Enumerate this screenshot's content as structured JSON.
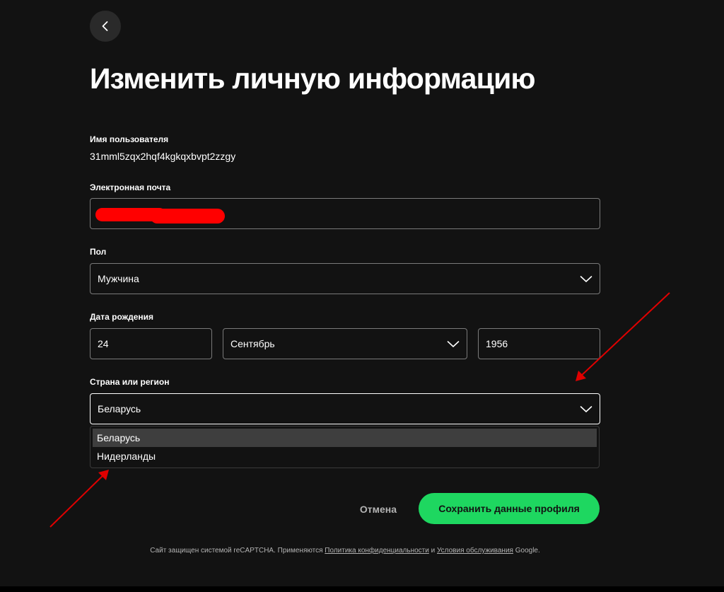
{
  "back_button": {
    "icon": "chevron-left-icon"
  },
  "page_title": "Изменить личную информацию",
  "username": {
    "label": "Имя пользователя",
    "value": "31mml5zqx2hqf4kgkqxbvpt2zzgy"
  },
  "email": {
    "label": "Электронная почта"
  },
  "gender": {
    "label": "Пол",
    "value": "Мужчина"
  },
  "birth_date": {
    "label": "Дата рождения",
    "day": "24",
    "month": "Сентябрь",
    "year": "1956"
  },
  "country": {
    "label": "Страна или регион",
    "value": "Беларусь",
    "options": [
      "Беларусь",
      "Нидерланды"
    ]
  },
  "actions": {
    "cancel_label": "Отмена",
    "save_label": "Сохранить данные профиля"
  },
  "footer": {
    "text_before": "Сайт защищен системой reCAPTCHA. Применяются",
    "privacy_link": "Политика конфиденциальности",
    "conjunction": "и",
    "terms_link": "Условия обслуживания",
    "text_after": "Google."
  },
  "colors": {
    "background": "#121212",
    "accent": "#1ed760",
    "annotation_arrow": "#e00000",
    "redaction": "#ff0000"
  }
}
